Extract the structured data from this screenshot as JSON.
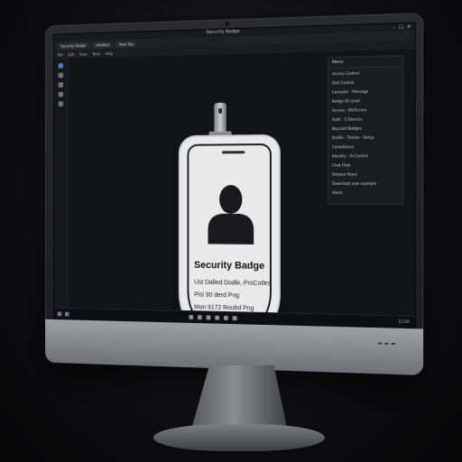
{
  "window": {
    "title": "Security Badge",
    "tabs": [
      "Security Badge",
      "Untitled",
      "New Tab"
    ],
    "toolbar": [
      "File",
      "Edit",
      "View",
      "Tools",
      "Help"
    ],
    "controls": [
      "–",
      "□",
      "✕"
    ]
  },
  "panel": {
    "header": "Menu",
    "items": [
      "Access Control",
      "Dell Control",
      "Compiler · Message",
      "Badge ID Level",
      "Access · 00/Access",
      "Auth · 5 Devices",
      "Keycard Badges",
      "Profile · Theme · Setup",
      "Compliance",
      "Identity · Hi Control",
      "Chat Flow",
      "Sidebar Panel",
      "Download new example",
      "Alerts"
    ]
  },
  "badge": {
    "title": "Security Badge",
    "lines": [
      "Ust Dalled Dodle, ProCoIles",
      "Pisl 90 derd Png",
      "Mon 9172 Roubd Png"
    ]
  },
  "taskbar": {
    "clock": "12:00"
  },
  "colors": {
    "background": "#0c0c0e",
    "badge": "#e9e9ea",
    "screen": "#131416"
  }
}
